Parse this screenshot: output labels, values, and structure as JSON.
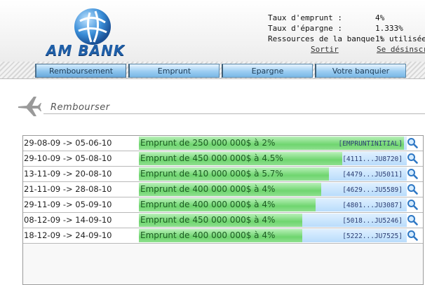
{
  "brand": {
    "name": "AM BANK",
    "color": "#1f5fa8"
  },
  "info": {
    "rows": [
      {
        "key": "Taux d'emprunt :",
        "value": "4%"
      },
      {
        "key": "Taux d'épargne :",
        "value": "1.333%"
      },
      {
        "key": "Ressources de la banque :",
        "value": "1% utilisées"
      }
    ],
    "logout": "Sortir",
    "unsubscribe": "Se désinscri"
  },
  "nav": {
    "tabs": [
      "Remboursement",
      "Emprunt",
      "Epargne",
      "Votre banquier"
    ],
    "active": 0
  },
  "section": {
    "title": "Rembourser",
    "icon": "airplane-icon"
  },
  "loans": [
    {
      "dates": "29-08-09 -> 05-06-10",
      "label": "Emprunt de 250 000 000$ à 2%",
      "ref": "[EMPRUNTINITIAL]",
      "progress": 0.99
    },
    {
      "dates": "29-10-09 -> 05-08-10",
      "label": "Emprunt de 450 000 000$ à 4.5%",
      "ref": "[4111...JU8720]",
      "progress": 0.76
    },
    {
      "dates": "13-11-09 -> 20-08-10",
      "label": "Emprunt de 410 000 000$ à 5.7%",
      "ref": "[4479...JU5011]",
      "progress": 0.71
    },
    {
      "dates": "21-11-09 -> 28-08-10",
      "label": "Emprunt de 400 000 000$ à 4%",
      "ref": "[4629...JU5589]",
      "progress": 0.68
    },
    {
      "dates": "29-11-09 -> 05-09-10",
      "label": "Emprunt de 400 000 000$ à 4%",
      "ref": "[4801...JU3087]",
      "progress": 0.66
    },
    {
      "dates": "08-12-09 -> 14-09-10",
      "label": "Emprunt de 450 000 000$ à 4%",
      "ref": "[5018...JU5246]",
      "progress": 0.61
    },
    {
      "dates": "18-12-09 -> 24-09-10",
      "label": "Emprunt de 400 000 000$ à 4%",
      "ref": "[5222...JU7525]",
      "progress": 0.61
    }
  ],
  "row_icon": "magnifier-icon"
}
